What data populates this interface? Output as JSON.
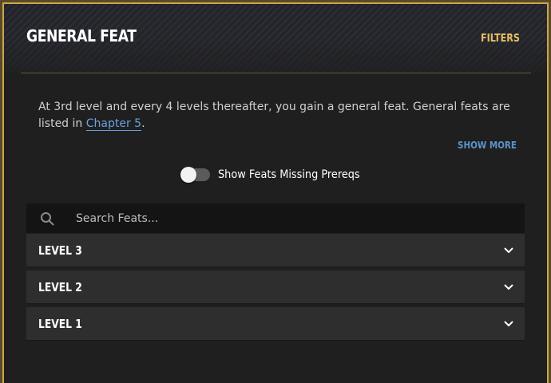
{
  "header": {
    "title": "GENERAL FEAT",
    "filters_label": "FILTERS"
  },
  "description": {
    "text_before_link": "At 3rd level and every 4 levels thereafter, you gain a general feat. General feats are listed in ",
    "link_text": "Chapter 5",
    "text_after_link": "."
  },
  "show_more_label": "SHOW MORE",
  "toggle": {
    "label": "Show Feats Missing Prereqs",
    "enabled": false
  },
  "search": {
    "placeholder": "Search Feats...",
    "value": ""
  },
  "levels": [
    {
      "label": "LEVEL 3"
    },
    {
      "label": "LEVEL 2"
    },
    {
      "label": "LEVEL 1"
    }
  ],
  "colors": {
    "frame_gold": "#c9a64e",
    "accent_gold": "#e8c064",
    "link_blue": "#6aa0e0",
    "row_bg": "#2e2e2e"
  },
  "icons": {
    "search": "search-icon",
    "chevron": "chevron-down-icon"
  }
}
